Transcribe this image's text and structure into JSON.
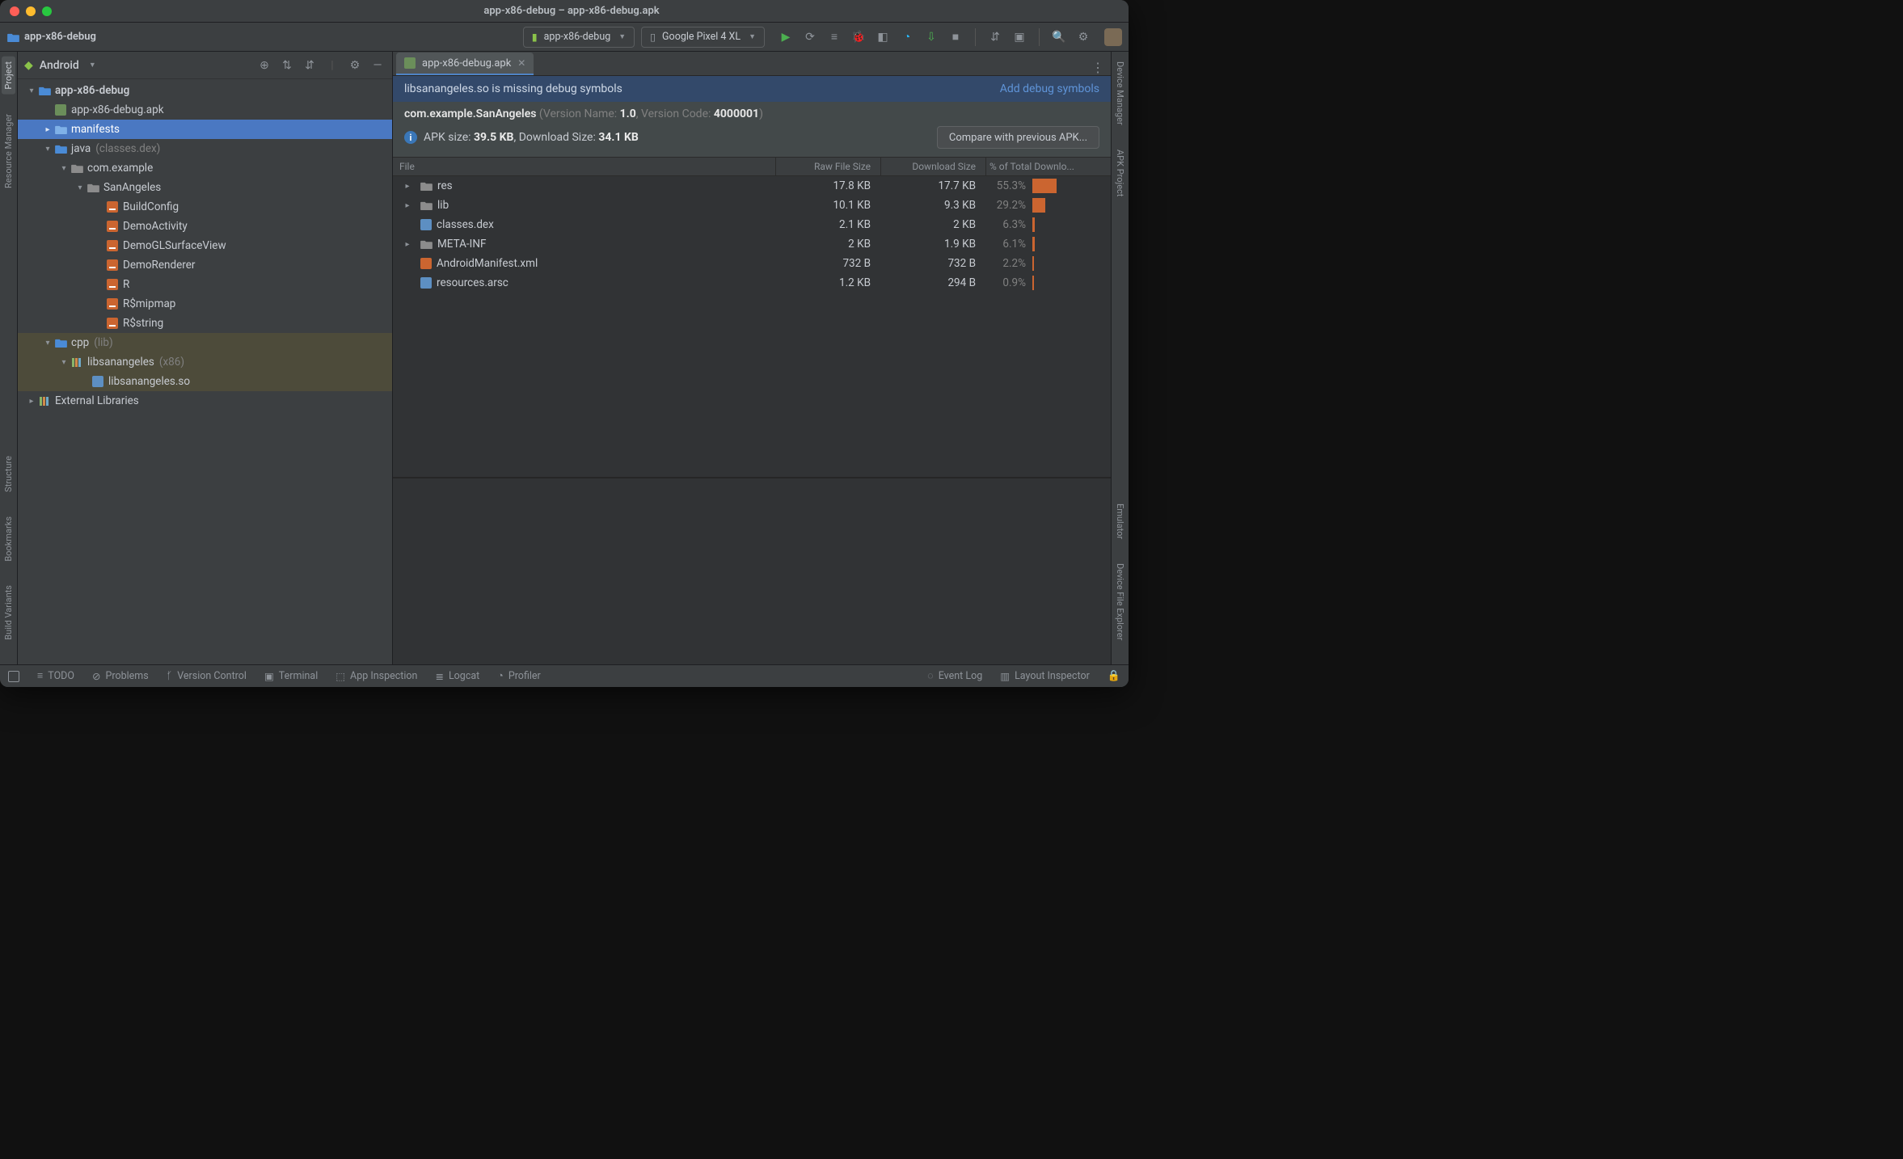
{
  "title": "app-x86-debug – app-x86-debug.apk",
  "breadcrumb": {
    "root": "app-x86-debug"
  },
  "toolbar": {
    "runConfig": "app-x86-debug",
    "device": "Google Pixel 4 XL"
  },
  "leftGutter": {
    "project": "Project",
    "resourceManager": "Resource Manager",
    "structure": "Structure",
    "bookmarks": "Bookmarks",
    "buildVariants": "Build Variants"
  },
  "rightGutter": {
    "deviceManager": "Device Manager",
    "apkProject": "APK Project",
    "emulator": "Emulator",
    "deviceFileExplorer": "Device File Explorer"
  },
  "projectPanel": {
    "viewMode": "Android",
    "tree": {
      "root": "app-x86-debug",
      "apk": "app-x86-debug.apk",
      "manifests": "manifests",
      "java": "java",
      "javaNote": "(classes.dex)",
      "pkg": "com.example",
      "cls": "SanAngeles",
      "files": [
        "BuildConfig",
        "DemoActivity",
        "DemoGLSurfaceView",
        "DemoRenderer",
        "R",
        "R$mipmap",
        "R$string"
      ],
      "cpp": "cpp",
      "cppNote": "(lib)",
      "libFolder": "libsanangeles",
      "libNote": "(x86)",
      "libFile": "libsanangeles.so",
      "external": "External Libraries"
    }
  },
  "editor": {
    "tab": "app-x86-debug.apk",
    "banner": {
      "msg": "libsanangeles.so is missing debug symbols",
      "action": "Add debug symbols"
    },
    "package": "com.example.SanAngeles",
    "versionNameLabel": "(Version Name: ",
    "versionName": "1.0",
    "versionCodeLabel": ", Version Code: ",
    "versionCode": "4000001",
    "versionClose": ")",
    "apkSizeLabel": "APK size: ",
    "apkSize": "39.5 KB",
    "dlSizeLabel": ", Download Size: ",
    "dlSize": "34.1 KB",
    "compareBtn": "Compare with previous APK...",
    "columns": {
      "file": "File",
      "raw": "Raw File Size",
      "dl": "Download Size",
      "pct": "% of Total Downlo..."
    },
    "rows": [
      {
        "expand": true,
        "icon": "folder",
        "name": "res",
        "raw": "17.8 KB",
        "dl": "17.7 KB",
        "pct": "55.3%",
        "bar": 55.3
      },
      {
        "expand": true,
        "icon": "folder",
        "name": "lib",
        "raw": "10.1 KB",
        "dl": "9.3 KB",
        "pct": "29.2%",
        "bar": 29.2
      },
      {
        "expand": false,
        "icon": "dex",
        "name": "classes.dex",
        "raw": "2.1 KB",
        "dl": "2 KB",
        "pct": "6.3%",
        "bar": 6.3
      },
      {
        "expand": true,
        "icon": "folder",
        "name": "META-INF",
        "raw": "2 KB",
        "dl": "1.9 KB",
        "pct": "6.1%",
        "bar": 6.1
      },
      {
        "expand": false,
        "icon": "xml",
        "name": "AndroidManifest.xml",
        "raw": "732 B",
        "dl": "732 B",
        "pct": "2.2%",
        "bar": 2.2
      },
      {
        "expand": false,
        "icon": "arsc",
        "name": "resources.arsc",
        "raw": "1.2 KB",
        "dl": "294 B",
        "pct": "0.9%",
        "bar": 0.9
      }
    ]
  },
  "status": {
    "todo": "TODO",
    "problems": "Problems",
    "vcs": "Version Control",
    "terminal": "Terminal",
    "appInspection": "App Inspection",
    "logcat": "Logcat",
    "profiler": "Profiler",
    "eventLog": "Event Log",
    "layoutInspector": "Layout Inspector"
  }
}
